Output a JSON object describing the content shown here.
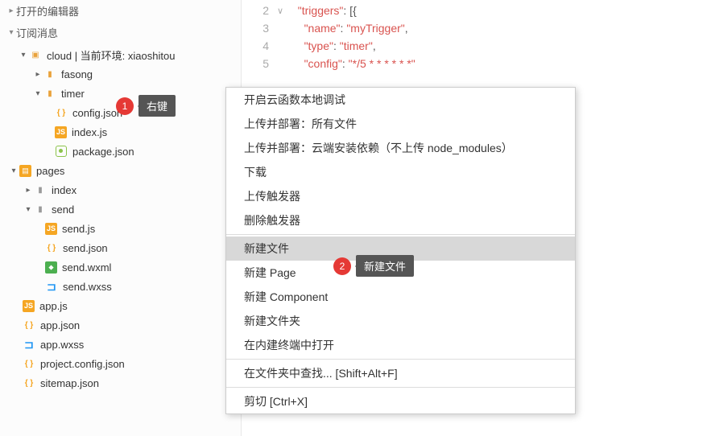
{
  "sidebar": {
    "openEditors": "打开的编辑器",
    "subscribe": "订阅消息",
    "cloudLabel": "cloud | 当前环境: xiaoshitou",
    "fasong": "fasong",
    "timer": "timer",
    "configJson": "config.json",
    "indexJs": "index.js",
    "packageJson": "package.json",
    "pages": "pages",
    "index": "index",
    "send": "send",
    "sendJs": "send.js",
    "sendJson": "send.json",
    "sendWxml": "send.wxml",
    "sendWxss": "send.wxss",
    "appJs": "app.js",
    "appJson": "app.json",
    "appWxss": "app.wxss",
    "projectConfig": "project.config.json",
    "sitemap": "sitemap.json"
  },
  "annotations": {
    "a1num": "1",
    "a1text": "右键",
    "a2num": "2",
    "a2text": "新建文件"
  },
  "editor": {
    "lines": [
      {
        "n": "2",
        "fold": "∨",
        "tokens": [
          [
            "  ",
            "p"
          ],
          [
            "\"triggers\"",
            "s"
          ],
          [
            ": [{",
            "p"
          ]
        ]
      },
      {
        "n": "3",
        "fold": "",
        "tokens": [
          [
            "    ",
            "p"
          ],
          [
            "\"name\"",
            "s"
          ],
          [
            ": ",
            "p"
          ],
          [
            "\"myTrigger\"",
            "s"
          ],
          [
            ",",
            "p"
          ]
        ]
      },
      {
        "n": "4",
        "fold": "",
        "tokens": [
          [
            "    ",
            "p"
          ],
          [
            "\"type\"",
            "s"
          ],
          [
            ": ",
            "p"
          ],
          [
            "\"timer\"",
            "s"
          ],
          [
            ",",
            "p"
          ]
        ]
      },
      {
        "n": "5",
        "fold": "",
        "tokens": [
          [
            "    ",
            "p"
          ],
          [
            "\"config\"",
            "s"
          ],
          [
            ": ",
            "p"
          ],
          [
            "\"*/5 * * * * * *\"",
            "s"
          ]
        ]
      }
    ]
  },
  "contextMenu": {
    "items": [
      {
        "label": "开启云函数本地调试",
        "sep": false
      },
      {
        "label": "上传并部署：所有文件",
        "sep": false
      },
      {
        "label": "上传并部署：云端安装依赖（不上传 node_modules）",
        "sep": false
      },
      {
        "label": "下载",
        "sep": false
      },
      {
        "label": "上传触发器",
        "sep": false
      },
      {
        "label": "删除触发器",
        "sep": false
      },
      {
        "label": "",
        "sep": true
      },
      {
        "label": "新建文件",
        "sep": false,
        "hl": true
      },
      {
        "label": "新建 Page",
        "sep": false
      },
      {
        "label": "新建 Component",
        "sep": false
      },
      {
        "label": "新建文件夹",
        "sep": false
      },
      {
        "label": "在内建终端中打开",
        "sep": false
      },
      {
        "label": "",
        "sep": true
      },
      {
        "label": "在文件夹中查找...  [Shift+Alt+F]",
        "sep": false
      },
      {
        "label": "",
        "sep": true
      },
      {
        "label": "剪切  [Ctrl+X]",
        "sep": false
      }
    ]
  }
}
